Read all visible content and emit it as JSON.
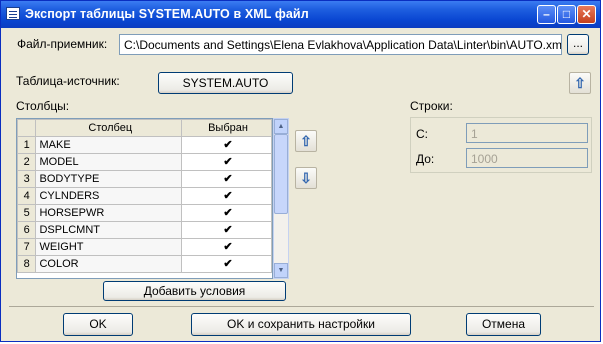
{
  "window": {
    "title": "Экспорт таблицы SYSTEM.AUTO в XML файл",
    "controls": {
      "minimize": "–",
      "maximize": "□",
      "close": "✕"
    }
  },
  "file": {
    "label": "Файл-приемник:",
    "value": "C:\\Documents and Settings\\Elena Evlakhova\\Application Data\\Linter\\bin\\AUTO.xml",
    "browse_label": "..."
  },
  "source": {
    "label": "Таблица-источник:",
    "button_label": "SYSTEM.AUTO"
  },
  "columns": {
    "label": "Столбцы:",
    "headers": {
      "index": "",
      "name": "Столбец",
      "selected": "Выбран"
    },
    "rows": [
      {
        "index": "1",
        "name": "MAKE",
        "checked": true
      },
      {
        "index": "2",
        "name": "MODEL",
        "checked": true
      },
      {
        "index": "3",
        "name": "BODYTYPE",
        "checked": true
      },
      {
        "index": "4",
        "name": "CYLNDERS",
        "checked": true
      },
      {
        "index": "5",
        "name": "HORSEPWR",
        "checked": true
      },
      {
        "index": "6",
        "name": "DSPLCMNT",
        "checked": true
      },
      {
        "index": "7",
        "name": "WEIGHT",
        "checked": true
      },
      {
        "index": "8",
        "name": "COLOR",
        "checked": true
      }
    ],
    "add_conditions_label": "Добавить условия",
    "move_up_icon": "arrow-up-icon",
    "move_down_icon": "arrow-down-icon"
  },
  "rows_range": {
    "label": "Строки:",
    "from_label": "С:",
    "from_value": "1",
    "to_label": "До:",
    "to_value": "1000"
  },
  "footer": {
    "ok_label": "OK",
    "ok_save_label": "OK и сохранить настройки",
    "cancel_label": "Отмена"
  },
  "colors": {
    "titlebar": "#0a46d2",
    "window_bg": "#ece9d8",
    "arrow_icon": "#3669b0"
  }
}
